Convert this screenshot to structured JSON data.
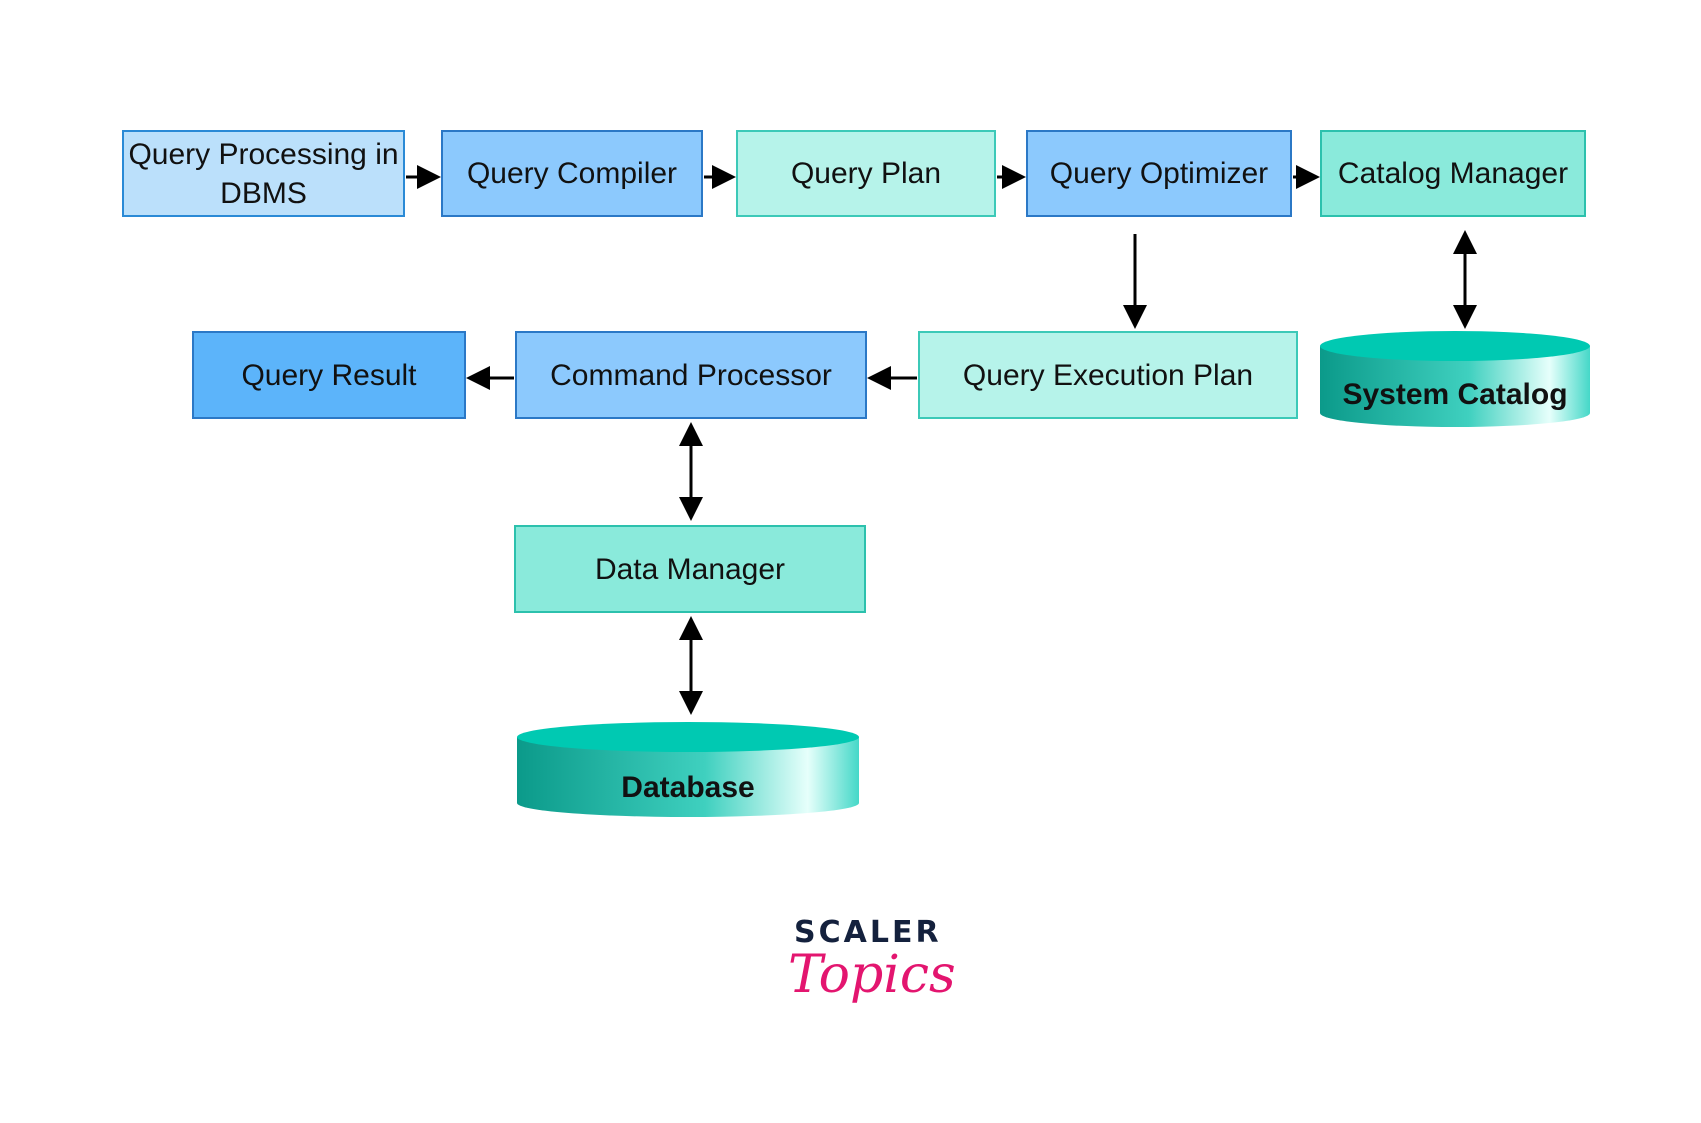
{
  "nodes": {
    "query_processing": "Query Processing in DBMS",
    "query_compiler": "Query Compiler",
    "query_plan": "Query Plan",
    "query_optimizer": "Query Optimizer",
    "catalog_manager": "Catalog Manager",
    "query_result": "Query Result",
    "command_processor": "Command Processor",
    "query_execution_plan": "Query Execution Plan",
    "system_catalog": "System Catalog",
    "data_manager": "Data Manager",
    "database": "Database"
  },
  "edges": [
    {
      "from": "Query Processing in DBMS",
      "to": "Query Compiler",
      "type": "directed"
    },
    {
      "from": "Query Compiler",
      "to": "Query Plan",
      "type": "directed"
    },
    {
      "from": "Query Plan",
      "to": "Query Optimizer",
      "type": "directed"
    },
    {
      "from": "Query Optimizer",
      "to": "Catalog Manager",
      "type": "directed"
    },
    {
      "from": "Query Optimizer",
      "to": "Query Execution Plan",
      "type": "directed"
    },
    {
      "from": "Catalog Manager",
      "to": "System Catalog",
      "type": "bidirectional"
    },
    {
      "from": "Query Execution Plan",
      "to": "Command Processor",
      "type": "directed"
    },
    {
      "from": "Command Processor",
      "to": "Query Result",
      "type": "directed"
    },
    {
      "from": "Command Processor",
      "to": "Data Manager",
      "type": "bidirectional"
    },
    {
      "from": "Data Manager",
      "to": "Database",
      "type": "bidirectional"
    }
  ],
  "logo": {
    "line1": "SCALER",
    "line2": "Topics"
  },
  "colors": {
    "arrow": "#000000",
    "cylinder_top": "#00c9b2",
    "logo_dark": "#14213d",
    "logo_pink": "#e3156f"
  }
}
